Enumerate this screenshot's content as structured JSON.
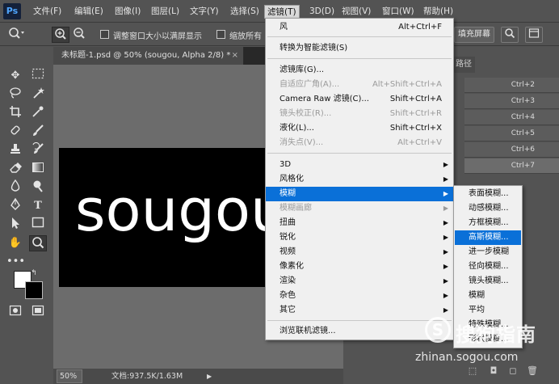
{
  "app": {
    "logo": "Ps"
  },
  "menubar": {
    "items": [
      {
        "label": "文件(F)"
      },
      {
        "label": "编辑(E)"
      },
      {
        "label": "图像(I)"
      },
      {
        "label": "图层(L)"
      },
      {
        "label": "文字(Y)"
      },
      {
        "label": "选择(S)"
      },
      {
        "label": "滤镜(T)",
        "active": true
      },
      {
        "label": "3D(D)"
      },
      {
        "label": "视图(V)"
      },
      {
        "label": "窗口(W)"
      },
      {
        "label": "帮助(H)"
      }
    ]
  },
  "options_bar": {
    "tool_icon": "zoom-icon",
    "resize_windows_label": "调整窗口大小以满屏显示",
    "zoom_all_label": "缩放所有",
    "fill_screen_label": "填充屏幕"
  },
  "document": {
    "tab_title": "未标题-1.psd @ 50% (sougou, Alpha 2/8) *",
    "close_glyph": "×",
    "canvas_text": "sougou",
    "zoom": "50%",
    "doc_size": "文档:937.5K/1.63M"
  },
  "right_panel": {
    "tab_label": "路径",
    "channel_shortcuts": [
      "Ctrl+2",
      "Ctrl+3",
      "Ctrl+4",
      "Ctrl+5",
      "Ctrl+6",
      "Ctrl+7"
    ]
  },
  "filter_menu": {
    "items": [
      {
        "label": "风",
        "shortcut": "Alt+Ctrl+F"
      },
      {
        "separator": true
      },
      {
        "label": "转换为智能滤镜(S)"
      },
      {
        "separator": true
      },
      {
        "label": "滤镜库(G)..."
      },
      {
        "label": "自适应广角(A)...",
        "shortcut": "Alt+Shift+Ctrl+A",
        "disabled": true
      },
      {
        "label": "Camera Raw 滤镜(C)...",
        "shortcut": "Shift+Ctrl+A"
      },
      {
        "label": "镜头校正(R)...",
        "shortcut": "Shift+Ctrl+R",
        "disabled": true
      },
      {
        "label": "液化(L)...",
        "shortcut": "Shift+Ctrl+X"
      },
      {
        "label": "消失点(V)...",
        "shortcut": "Alt+Ctrl+V",
        "disabled": true
      },
      {
        "separator": true
      },
      {
        "label": "3D",
        "submenu": true
      },
      {
        "label": "风格化",
        "submenu": true
      },
      {
        "label": "模糊",
        "submenu": true,
        "highlight": true
      },
      {
        "label": "模糊画廊",
        "submenu": true,
        "disabled": true
      },
      {
        "label": "扭曲",
        "submenu": true
      },
      {
        "label": "锐化",
        "submenu": true
      },
      {
        "label": "视频",
        "submenu": true
      },
      {
        "label": "像素化",
        "submenu": true
      },
      {
        "label": "渲染",
        "submenu": true
      },
      {
        "label": "杂色",
        "submenu": true
      },
      {
        "label": "其它",
        "submenu": true
      },
      {
        "separator": true
      },
      {
        "label": "浏览联机滤镜..."
      }
    ]
  },
  "blur_submenu": {
    "items": [
      {
        "label": "表面模糊..."
      },
      {
        "label": "动感模糊..."
      },
      {
        "label": "方框模糊..."
      },
      {
        "label": "高斯模糊...",
        "highlight": true
      },
      {
        "label": "进一步模糊"
      },
      {
        "label": "径向模糊..."
      },
      {
        "label": "镜头模糊..."
      },
      {
        "label": "模糊"
      },
      {
        "label": "平均"
      },
      {
        "label": "特殊模糊..."
      },
      {
        "label": "形状模糊..."
      }
    ]
  },
  "watermark": {
    "logo_glyph": "S",
    "text": "搜狗指南",
    "url": "zhinan.sogou.com"
  },
  "colors": {
    "ui_bg": "#535353",
    "menu_bg": "#f0f0f0",
    "highlight": "#0a70d8",
    "canvas": "#000000"
  }
}
